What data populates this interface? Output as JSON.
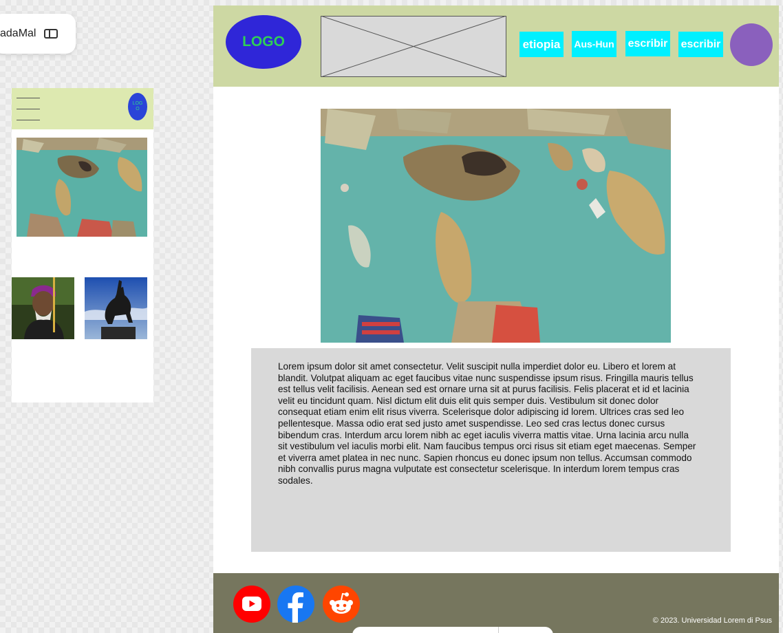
{
  "file_chip": {
    "name": "adaMal",
    "icon": "sidebar-panel-icon"
  },
  "mobile": {
    "logo_text": "LOGO",
    "menu_icon": "hamburger-icon"
  },
  "desktop": {
    "logo_text": "LOGO",
    "nav": [
      "etiopia",
      "Aus-Hun",
      "escribir",
      "escribir"
    ],
    "body_text": "Lorem ipsum dolor sit amet consectetur. Velit suscipit nulla imperdiet dolor eu. Libero et lorem at blandit. Volutpat aliquam ac eget faucibus vitae nunc suspendisse ipsum risus. Fringilla mauris tellus est tellus velit facilisis. Aenean sed est ornare urna sit at purus facilisis. Felis placerat et id et lacinia velit eu tincidunt quam. Nisl dictum elit duis elit quis semper duis. Vestibulum sit donec dolor consequat etiam enim elit risus viverra. Scelerisque dolor adipiscing id lorem. Ultrices cras sed leo pellentesque. Massa odio erat sed justo amet suspendisse. Leo sed cras lectus donec cursus bibendum cras. Interdum arcu lorem nibh ac eget iaculis viverra mattis vitae. Urna lacinia arcu nulla sit vestibulum vel iaculis morbi elit. Nam faucibus tempus orci risus sit etiam eget maecenas. Semper et viverra amet platea in nec nunc. Sapien rhoncus eu donec ipsum non tellus. Accumsan commodo nibh convallis purus magna vulputate est consectetur scelerisque. In interdum lorem tempus cras sodales.",
    "copyright": "© 2023. Universidad Lorem di Psus",
    "social": [
      "youtube-icon",
      "facebook-icon",
      "reddit-icon"
    ]
  },
  "colors": {
    "header_bg": "#cdd8a3",
    "mobile_header_bg": "#dde9b0",
    "logo_bg": "#2f26d8",
    "nav_bg": "#00f0ff",
    "avatar": "#8a60bd",
    "footer_bg": "#76765e",
    "text_box_bg": "#d9d9d9"
  }
}
